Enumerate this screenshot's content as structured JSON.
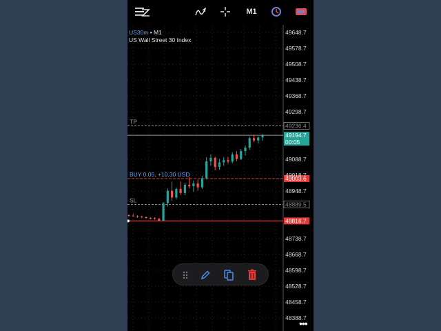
{
  "toolbar": {
    "menu_icon": "menu-icon",
    "indicator_icon": "indicator-icon",
    "crosshair_icon": "crosshair-icon",
    "timeframe_label": "M1",
    "clock_icon": "clock-icon",
    "trade_icon": "trade-icon"
  },
  "chart_info": {
    "symbol": "US30m",
    "separator": " • ",
    "timeframe": "M1",
    "description": "US Wall Street 30 Index"
  },
  "price_scale": {
    "ticks": [
      "49648.7",
      "49578.7",
      "49508.7",
      "49438.7",
      "49368.7",
      "49298.7",
      "49088.7",
      "49018.7",
      "48948.7",
      "48738.7",
      "48668.7",
      "48598.7",
      "48528.7",
      "48458.7",
      "48388.7"
    ]
  },
  "levels": {
    "tp": {
      "label": "TP",
      "price": "49236.4"
    },
    "current": {
      "price": "49194.7",
      "timer": "00:05"
    },
    "buy": {
      "label": "BUY 0.05, +10.30 USD",
      "price": "49003.6"
    },
    "sl": {
      "label": "SL",
      "price": "48889.5"
    },
    "red": {
      "price": "48816.7"
    }
  },
  "colors": {
    "bull": "#26a69a",
    "bear": "#ef5350",
    "buy_line": "#e53935",
    "current_price_bg": "#26a69a",
    "symbol_text": "#6e9fe8",
    "grid": "#2a2a2a"
  },
  "float_toolbar": {
    "items": [
      "drag-handle-icon",
      "edit-icon",
      "copy-icon",
      "delete-icon"
    ]
  },
  "bottom_menu": {
    "icon": "more-icon"
  },
  "chart_data": {
    "type": "candlestick",
    "symbol": "US30m",
    "timeframe": "M1",
    "ylim": [
      48370,
      49670
    ],
    "ohlc": [
      [
        48842,
        48846,
        48835,
        48840
      ],
      [
        48840,
        48848,
        48836,
        48838
      ],
      [
        48838,
        48842,
        48830,
        48836
      ],
      [
        48836,
        48840,
        48828,
        48833
      ],
      [
        48833,
        48837,
        48825,
        48830
      ],
      [
        48830,
        48834,
        48823,
        48829
      ],
      [
        48829,
        48833,
        48822,
        48826
      ],
      [
        48826,
        48830,
        48816,
        48818
      ],
      [
        48818,
        48900,
        48816,
        48895
      ],
      [
        48895,
        48960,
        48880,
        48950
      ],
      [
        48950,
        48990,
        48905,
        48920
      ],
      [
        48920,
        48965,
        48912,
        48958
      ],
      [
        48958,
        48990,
        48932,
        48940
      ],
      [
        48940,
        48985,
        48930,
        48976
      ],
      [
        48976,
        49010,
        48960,
        48970
      ],
      [
        48970,
        48995,
        48945,
        48982
      ],
      [
        48982,
        49000,
        48950,
        48965
      ],
      [
        48965,
        49015,
        48958,
        49005
      ],
      [
        49005,
        49098,
        49000,
        49080
      ],
      [
        49080,
        49110,
        49060,
        49095
      ],
      [
        49095,
        49100,
        49040,
        49055
      ],
      [
        49055,
        49090,
        49042,
        49075
      ],
      [
        49075,
        49098,
        49060,
        49085
      ],
      [
        49085,
        49100,
        49070,
        49078
      ],
      [
        49078,
        49120,
        49070,
        49110
      ],
      [
        49110,
        49125,
        49080,
        49090
      ],
      [
        49090,
        49135,
        49085,
        49125
      ],
      [
        49125,
        49150,
        49105,
        49140
      ],
      [
        49140,
        49190,
        49130,
        49182
      ],
      [
        49182,
        49198,
        49165,
        49172
      ],
      [
        49172,
        49190,
        49158,
        49185
      ],
      [
        49185,
        49200,
        49170,
        49194
      ]
    ]
  }
}
